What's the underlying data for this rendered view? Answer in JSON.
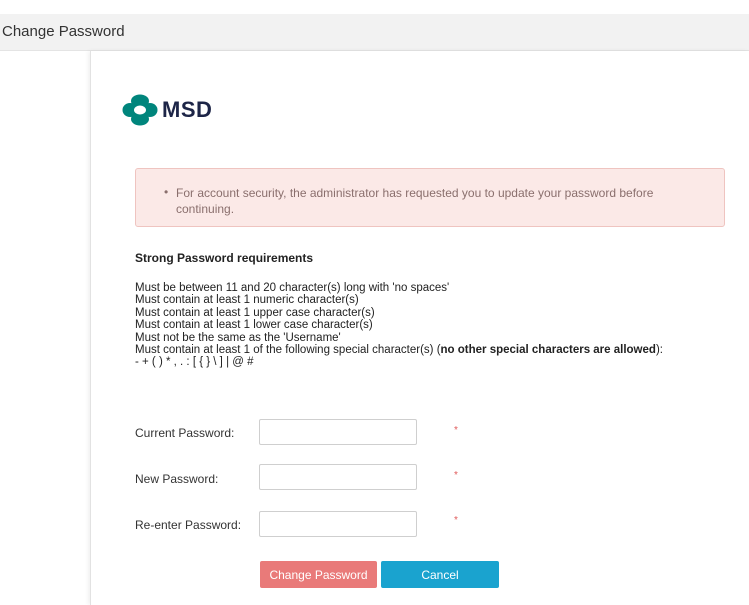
{
  "window": {
    "title": "Change Password"
  },
  "brand": {
    "name": "MSD",
    "logo_color": "#00857c",
    "text_color": "#1d2547"
  },
  "alert": {
    "message": "For account security, the administrator has requested you to update your password before continuing."
  },
  "requirements": {
    "title": "Strong Password requirements",
    "items": [
      "Must be between 11 and 20 character(s) long with 'no spaces'",
      "Must contain at least 1 numeric character(s)",
      "Must contain at least 1 upper case character(s)",
      "Must contain at least 1 lower case character(s)",
      "Must not be the same as the 'Username'"
    ],
    "special_prefix": "Must contain at least 1 of the following special character(s) (",
    "special_bold": "no other special characters are allowed",
    "special_suffix": "):",
    "special_chars": "- + ( ) * , . : [ { } \\ ] | @ #"
  },
  "form": {
    "current_label": "Current Password:",
    "current_value": "",
    "new_label": "New Password:",
    "new_value": "",
    "reenter_label": "Re-enter Password:",
    "reenter_value": "",
    "required_marker": "*"
  },
  "buttons": {
    "change_label": "Change Password",
    "cancel_label": "Cancel"
  },
  "colors": {
    "alert_bg": "#fbe9e7",
    "change_button": "#e97a79",
    "cancel_button": "#1aa3cf",
    "required": "#e05a5a"
  }
}
